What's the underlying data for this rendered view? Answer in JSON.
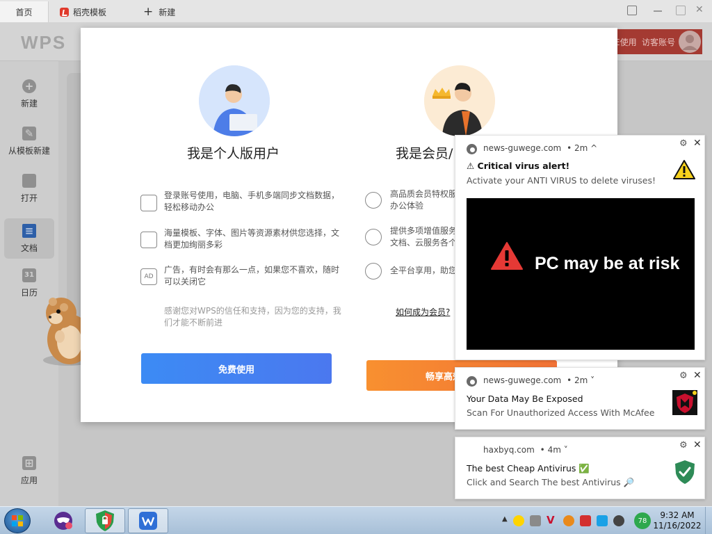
{
  "tabs": {
    "home": "首页",
    "template": "稻壳模板",
    "new": "新建"
  },
  "header": {
    "logo": "WPS",
    "user_prefix": "E使用",
    "guest": "访客账号"
  },
  "sidebar": {
    "items": [
      {
        "label": "新建",
        "icon": "plus-icon"
      },
      {
        "label": "从模板新建",
        "icon": "template-icon"
      },
      {
        "label": "打开",
        "icon": "folder-icon"
      },
      {
        "label": "文档",
        "icon": "document-icon"
      },
      {
        "label": "日历",
        "icon": "calendar-icon"
      },
      {
        "label": "应用",
        "icon": "apps-icon"
      }
    ],
    "calendar_day": "31"
  },
  "modal": {
    "personal": {
      "title": "我是个人版用户",
      "features": [
        "登录账号使用，电脑、手机多端同步文档数据，轻松移动办公",
        "海量模板、字体、图片等资源素材供您选择，文档更加绚丽多彩",
        "广告，有时会有那么一点，如果您不喜欢，随时可以关闭它"
      ],
      "thanks": "感谢您对WPS的信任和支持，因为您的支持，我们才能不断前进",
      "button": "免费使用",
      "ad_icon_text": "AD"
    },
    "member": {
      "title": "我是会员/",
      "features": [
        "高品质会员特权服\n办公体验",
        "提供多项增值服务\n文档、云服务各个",
        "全平台享用，助您"
      ],
      "link": "如何成为会员?",
      "button": "畅享高效办公体验"
    }
  },
  "notifications": [
    {
      "site": "news-guwege.com",
      "time": "• 2m ^",
      "title": "⚠ Critical virus alert!",
      "body": "Activate your ANTI VIRUS to delete viruses!",
      "image_text": "PC may be at risk"
    },
    {
      "site": "news-guwege.com",
      "time": "• 2m ˅",
      "title": "Your Data May Be Exposed",
      "body": "Scan For Unauthorized Access With McAfee"
    },
    {
      "site": "haxbyq.com",
      "time": "• 4m ˅",
      "title": "The best Cheap Antivirus ✅",
      "body": "Click and Search The best Antivirus 🔎"
    }
  ],
  "taskbar": {
    "tray_badge": "78",
    "time": "9:32 AM",
    "date": "11/16/2022"
  },
  "colors": {
    "accent_blue": "#3c8bf4",
    "accent_orange": "#f89030",
    "warning_red": "#e53935",
    "guest_chip": "#a43a32"
  }
}
